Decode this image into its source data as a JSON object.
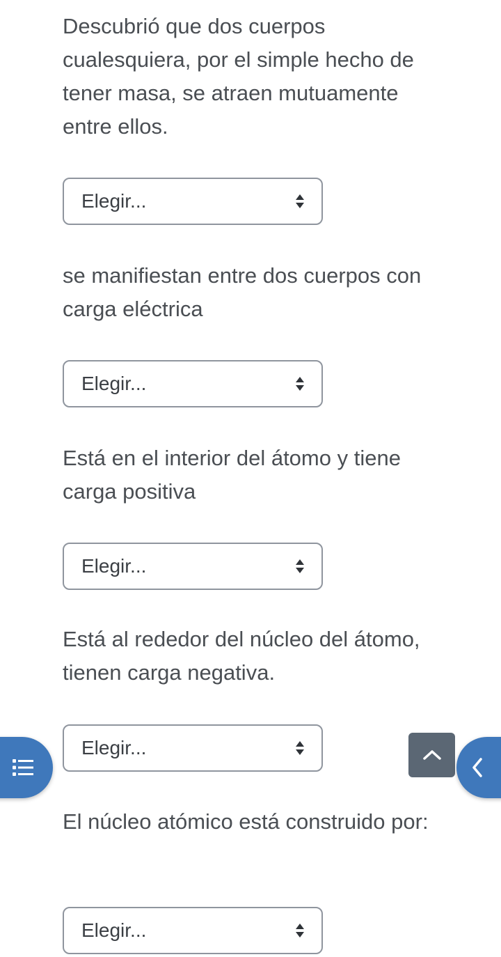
{
  "questions": [
    {
      "text": "Descubrió que dos cuerpos cualesquiera, por el simple hecho de tener masa, se atraen mutuamente entre ellos.",
      "select": "Elegir..."
    },
    {
      "text": "se manifiestan entre dos cuerpos con carga eléctrica",
      "select": "Elegir..."
    },
    {
      "text": "Está en el interior del átomo y tiene carga positiva",
      "select": "Elegir..."
    },
    {
      "text": "Está al rededor del núcleo del átomo, tienen carga negativa.",
      "select": "Elegir..."
    },
    {
      "text": "El núcleo atómico está construido por:",
      "select": "Elegir..."
    }
  ],
  "icons": {
    "drawer_toggle": "list-icon",
    "back_to_top": "chevron-up-icon",
    "sidebar_toggle": "chevron-left-icon",
    "select_arrows": "sort-arrows-icon"
  },
  "colors": {
    "primary": "#3f78bb",
    "secondary": "#5b6774",
    "text": "#4a4e53",
    "border": "#8f959e"
  }
}
